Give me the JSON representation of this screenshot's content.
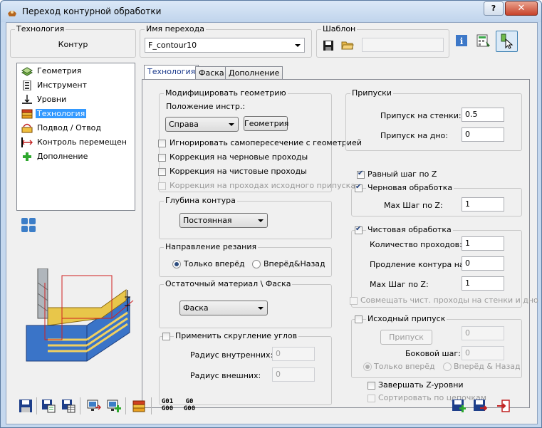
{
  "window": {
    "title": "Переход контурной обработки",
    "help_label": "?",
    "close_label": "✕"
  },
  "header": {
    "technology_label": "Технология",
    "technology_value": "Контур",
    "op_name_label": "Имя перехода",
    "op_name_value": "F_contour10",
    "template_label": "Шаблон",
    "template_value": ""
  },
  "tree": {
    "items": [
      {
        "label": "Геометрия",
        "icon": "geometry-icon"
      },
      {
        "label": "Инструмент",
        "icon": "tool-icon"
      },
      {
        "label": "Уровни",
        "icon": "levels-icon"
      },
      {
        "label": "Технология",
        "icon": "technology-icon",
        "selected": true
      },
      {
        "label": "Подвод / Отвод",
        "icon": "lead-in-out-icon"
      },
      {
        "label": "Контроль перемещен",
        "icon": "motion-control-icon"
      },
      {
        "label": "Дополнение",
        "icon": "misc-icon"
      }
    ]
  },
  "tabs": [
    "Технология",
    "Фаска",
    "Дополнение"
  ],
  "modify": {
    "title": "Модифицировать геометрию",
    "tool_position_label": "Положение инстр.:",
    "tool_position_value": "Справа",
    "geometry_button": "Геометрия",
    "ignore_self_intersection": "Игнорировать самопересечение с геометрией",
    "rough_comp": "Коррекция на черновые проходы",
    "finish_comp": "Коррекция на чистовые проходы",
    "stock_comp": "Коррекция на проходах исходного припуска"
  },
  "depth": {
    "title": "Глубина контура",
    "value": "Постоянная"
  },
  "direction": {
    "title": "Направление резания",
    "forward": "Только вперёд",
    "both": "Вперёд&Назад"
  },
  "rest": {
    "title": "Остаточный материал \\ Фаска",
    "value": "Фаска"
  },
  "corner": {
    "title": "Применить скругление углов",
    "inner_label": "Радиус внутренних:",
    "inner_value": "0",
    "outer_label": "Радиус внешних:",
    "outer_value": "0"
  },
  "allowances": {
    "title": "Припуски",
    "wall_label": "Припуск на стенки:",
    "wall_value": "0.5",
    "floor_label": "Припуск на дно:",
    "floor_value": "0"
  },
  "equal_z": "Равный шаг по Z",
  "rough": {
    "title": "Черновая обработка",
    "max_z_label": "Max Шаг по Z:",
    "max_z_value": "1"
  },
  "finish": {
    "title": "Чистовая обработка",
    "passes_label": "Количество проходов:",
    "passes_value": "1",
    "extend_label": "Продление контура на:",
    "extend_value": "0",
    "max_z_label": "Max Шаг по Z:",
    "max_z_value": "1",
    "combine": "Совмещать чист. проходы на стенки и дно"
  },
  "stock": {
    "title": "Исходный припуск",
    "button": "Припуск",
    "stock_value": "0",
    "side_label": "Боковой шаг:",
    "side_value": "0",
    "forward": "Только вперёд",
    "both": "Вперёд & Назад"
  },
  "finish_z": "Завершать Z-уровни",
  "sort_chains": "Сортировать по цепочкам",
  "toolbar": {
    "gcode1_top": "G01",
    "gcode1_bottom": "G00",
    "gcode2_top": "G0",
    "gcode2_bottom": "G00"
  },
  "colors": {
    "accent": "#3399ff",
    "window_frame": "#c5d8ee",
    "close": "#c7422a"
  }
}
